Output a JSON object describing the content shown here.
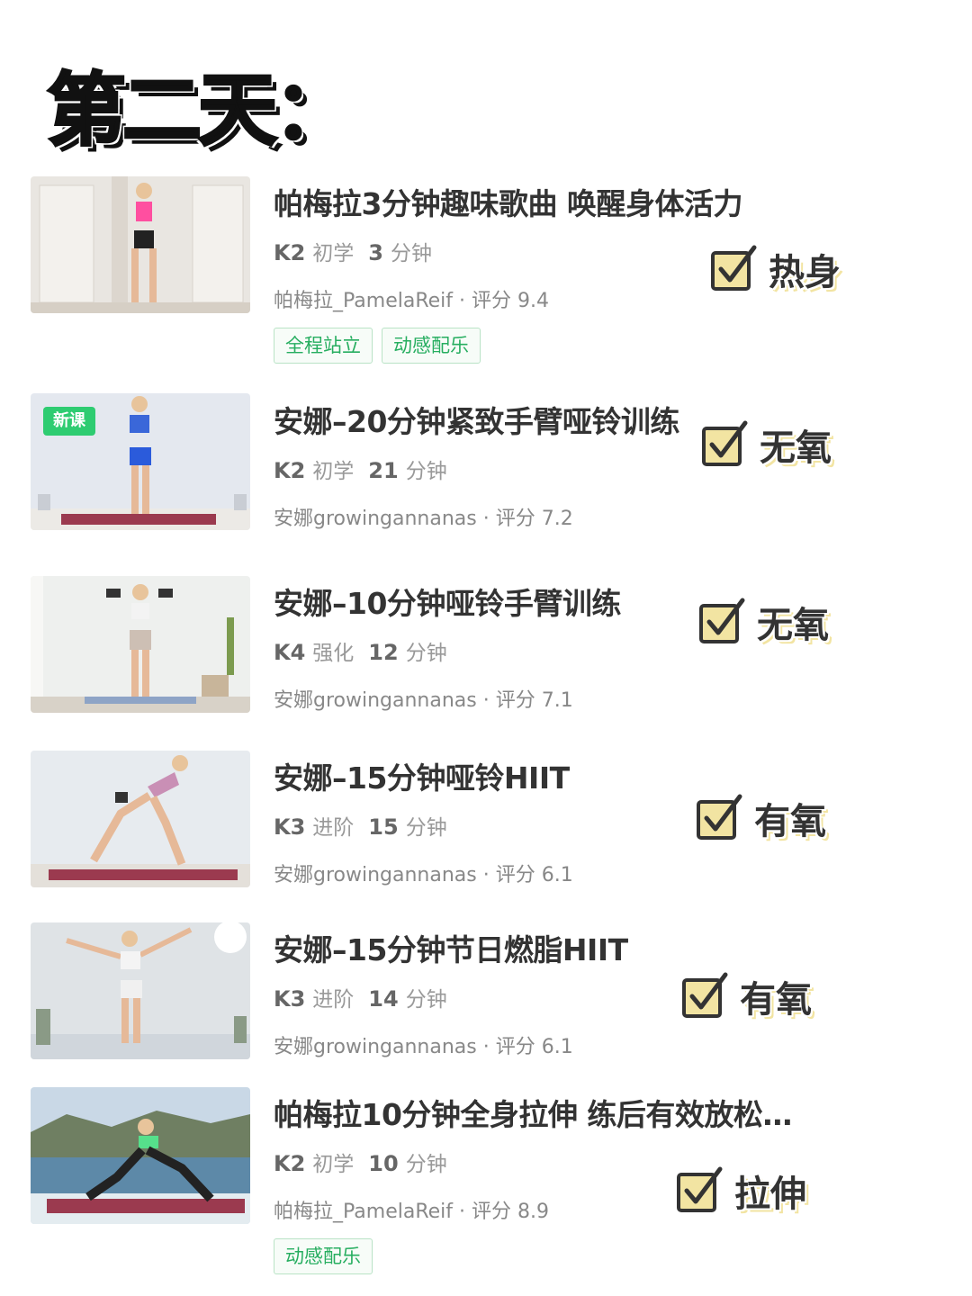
{
  "page": {
    "title": "第二天："
  },
  "courses": [
    {
      "title": "帕梅拉3分钟趣味歌曲 唤醒身体活力",
      "level_code": "K2",
      "level_name": "初学",
      "minutes": "3",
      "minutes_unit": "分钟",
      "author": "帕梅拉_PamelaReif",
      "rating_label": "评分",
      "rating": "9.4",
      "tags": [
        "全程站立",
        "动感配乐"
      ],
      "category": "热身"
    },
    {
      "title": "安娜–20分钟紧致手臂哑铃训练",
      "badge": "新课",
      "level_code": "K2",
      "level_name": "初学",
      "minutes": "21",
      "minutes_unit": "分钟",
      "author": "安娜growingannanas",
      "rating_label": "评分",
      "rating": "7.2",
      "tags": [],
      "category": "无氧"
    },
    {
      "title": "安娜–10分钟哑铃手臂训练",
      "level_code": "K4",
      "level_name": "强化",
      "minutes": "12",
      "minutes_unit": "分钟",
      "author": "安娜growingannanas",
      "rating_label": "评分",
      "rating": "7.1",
      "tags": [],
      "category": "无氧"
    },
    {
      "title": "安娜–15分钟哑铃HIIT",
      "level_code": "K3",
      "level_name": "进阶",
      "minutes": "15",
      "minutes_unit": "分钟",
      "author": "安娜growingannanas",
      "rating_label": "评分",
      "rating": "6.1",
      "tags": [],
      "category": "有氧"
    },
    {
      "title": "安娜–15分钟节日燃脂HIIT",
      "level_code": "K3",
      "level_name": "进阶",
      "minutes": "14",
      "minutes_unit": "分钟",
      "author": "安娜growingannanas",
      "rating_label": "评分",
      "rating": "6.1",
      "tags": [],
      "category": "有氧"
    },
    {
      "title": "帕梅拉10分钟全身拉伸 练后有效放松…",
      "level_code": "K2",
      "level_name": "初学",
      "minutes": "10",
      "minutes_unit": "分钟",
      "author": "帕梅拉_PamelaReif",
      "rating_label": "评分",
      "rating": "8.9",
      "tags": [
        "动感配乐"
      ],
      "category": "拉伸"
    }
  ],
  "colors": {
    "tag_green": "#27ae60",
    "badge_green": "#2ecc71",
    "check_fill": "#f2e4a2"
  }
}
